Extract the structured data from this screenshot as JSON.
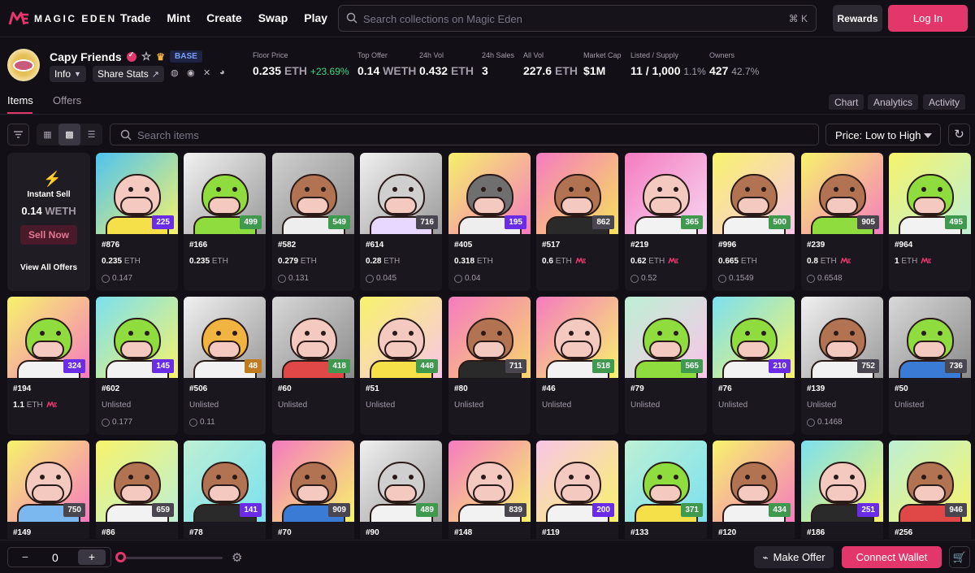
{
  "header": {
    "brand": "MAGIC EDEN",
    "nav": [
      "Trade",
      "Mint",
      "Create",
      "Swap",
      "Play"
    ],
    "search_placeholder": "Search collections on Magic Eden",
    "search_shortcut": "⌘ K",
    "rewards_label": "Rewards",
    "login_label": "Log In"
  },
  "collection": {
    "name": "Capy Friends",
    "chain": "BASE",
    "info_label": "Info",
    "share_label": "Share Stats",
    "stats": [
      {
        "label": "Floor Price",
        "value": "0.235",
        "unit": "ETH",
        "extra": "+23.69%"
      },
      {
        "label": "Top Offer",
        "value": "0.14",
        "unit": "WETH",
        "extra": ""
      },
      {
        "label": "24h Vol",
        "value": "0.432",
        "unit": "ETH",
        "extra": ""
      },
      {
        "label": "24h Sales",
        "value": "3",
        "unit": "",
        "extra": ""
      },
      {
        "label": "All Vol",
        "value": "227.6",
        "unit": "ETH",
        "extra": ""
      },
      {
        "label": "Market Cap",
        "value": "$1M",
        "unit": "",
        "extra": ""
      },
      {
        "label": "Listed / Supply",
        "value": "11 / 1,000",
        "unit": "",
        "extra": "1.1%"
      },
      {
        "label": "Owners",
        "value": "427",
        "unit": "",
        "extra": "42.7%"
      }
    ]
  },
  "tabs": {
    "items": "Items",
    "offers": "Offers",
    "right": [
      "Chart",
      "Analytics",
      "Activity"
    ]
  },
  "toolbar": {
    "search_placeholder": "Search items",
    "sort_label": "Price: Low to High"
  },
  "instant_sell": {
    "title": "Instant Sell",
    "price": "0.14",
    "unit": "WETH",
    "button": "Sell Now",
    "link": "View All Offers"
  },
  "cards": [
    {
      "id": "#876",
      "rank": "225",
      "rank_color": "#6b2ce8",
      "price": "0.235",
      "me": false,
      "last": "0.147",
      "bg": "linear-gradient(135deg,#4ec3f0,#f7f36b)",
      "body": "#f3c9c0",
      "shirt": "#f5e04a"
    },
    {
      "id": "#166",
      "rank": "499",
      "rank_color": "#3f9a4f",
      "price": "0.235",
      "me": false,
      "last": "",
      "bg": "linear-gradient(135deg,#f2f2f2,#9a9a9a)",
      "body": "#8fdc3f",
      "shirt": "#8fdc3f"
    },
    {
      "id": "#582",
      "rank": "549",
      "rank_color": "#3f9a4f",
      "price": "0.279",
      "me": false,
      "last": "0.131",
      "bg": "linear-gradient(135deg,#d0d0d0,#8a8a8a)",
      "body": "#b27352",
      "shirt": "#eeeeee"
    },
    {
      "id": "#614",
      "rank": "716",
      "rank_color": "#4a4650",
      "price": "0.28",
      "me": false,
      "last": "0.045",
      "bg": "linear-gradient(135deg,#f0f0f0,#9a9a9a)",
      "body": "#cfcfcf",
      "shirt": "#e8d7ff"
    },
    {
      "id": "#405",
      "rank": "195",
      "rank_color": "#6b2ce8",
      "price": "0.318",
      "me": false,
      "last": "0.04",
      "bg": "linear-gradient(135deg,#f5f06b,#f57bc0)",
      "body": "#6f6f6f",
      "shirt": "#eeeeee"
    },
    {
      "id": "#517",
      "rank": "862",
      "rank_color": "#4a4650",
      "price": "0.6",
      "me": true,
      "last": "",
      "bg": "linear-gradient(135deg,#f57bc0,#f7e35b)",
      "body": "#b27352",
      "shirt": "#2a2a2a"
    },
    {
      "id": "#219",
      "rank": "365",
      "rank_color": "#3f9a4f",
      "price": "0.62",
      "me": true,
      "last": "0.52",
      "bg": "linear-gradient(135deg,#f57bc0,#f6d7f2)",
      "body": "#f3c9c0",
      "shirt": "#f2f2f2"
    },
    {
      "id": "#996",
      "rank": "500",
      "rank_color": "#3f9a4f",
      "price": "0.665",
      "me": false,
      "last": "0.1549",
      "bg": "linear-gradient(135deg,#f7f36b,#f9c5e8)",
      "body": "#b27352",
      "shirt": "#f2f2f2"
    },
    {
      "id": "#239",
      "rank": "905",
      "rank_color": "#4a4650",
      "price": "0.8",
      "me": true,
      "last": "0.6548",
      "bg": "linear-gradient(135deg,#f7f36b,#f57bc0)",
      "body": "#b27352",
      "shirt": "#8fdc3f"
    },
    {
      "id": "#964",
      "rank": "495",
      "rank_color": "#3f9a4f",
      "price": "1",
      "me": true,
      "last": "",
      "bg": "linear-gradient(135deg,#f7f36b,#bdf0d4)",
      "body": "#8fdc3f",
      "shirt": "#f2f2f2"
    },
    {
      "id": "#194",
      "rank": "324",
      "rank_color": "#6b2ce8",
      "price": "1.1",
      "me": true,
      "last": "",
      "bg": "linear-gradient(135deg,#f7f36b,#f57bc0)",
      "body": "#8fdc3f",
      "shirt": "#f2f2f2"
    },
    {
      "id": "#602",
      "rank": "145",
      "rank_color": "#6b2ce8",
      "price": "",
      "me": false,
      "last": "0.177",
      "bg": "linear-gradient(135deg,#7be0f0,#f7f36b)",
      "body": "#8fdc3f",
      "shirt": "#f2f2f2"
    },
    {
      "id": "#506",
      "rank": "48",
      "rank_color": "#c07a1f",
      "price": "",
      "me": false,
      "last": "0.11",
      "bg": "linear-gradient(135deg,#f0f0f0,#9a9a9a)",
      "body": "#f2b441",
      "shirt": "#f2f2f2"
    },
    {
      "id": "#60",
      "rank": "418",
      "rank_color": "#3f9a4f",
      "price": "",
      "me": false,
      "last": "",
      "bg": "linear-gradient(135deg,#d8d8d8,#8a8a8a)",
      "body": "#f3c9c0",
      "shirt": "#e04848"
    },
    {
      "id": "#51",
      "rank": "448",
      "rank_color": "#3f9a4f",
      "price": "",
      "me": false,
      "last": "",
      "bg": "linear-gradient(135deg,#f7f36b,#f9c5e8)",
      "body": "#f3c9c0",
      "shirt": "#f5e04a"
    },
    {
      "id": "#80",
      "rank": "711",
      "rank_color": "#4a4650",
      "price": "",
      "me": false,
      "last": "",
      "bg": "linear-gradient(135deg,#f57bc0,#f7d66b)",
      "body": "#b27352",
      "shirt": "#2a2a2a"
    },
    {
      "id": "#46",
      "rank": "518",
      "rank_color": "#3f9a4f",
      "price": "",
      "me": false,
      "last": "",
      "bg": "linear-gradient(135deg,#f57bc0,#f7f36b)",
      "body": "#f3c9c0",
      "shirt": "#f2f2f2"
    },
    {
      "id": "#79",
      "rank": "565",
      "rank_color": "#3f9a4f",
      "price": "",
      "me": false,
      "last": "",
      "bg": "linear-gradient(135deg,#bdf0d4,#f9c5e8)",
      "body": "#8fdc3f",
      "shirt": "#8fdc3f"
    },
    {
      "id": "#76",
      "rank": "210",
      "rank_color": "#6b2ce8",
      "price": "",
      "me": false,
      "last": "",
      "bg": "linear-gradient(135deg,#7be0f0,#f7f36b)",
      "body": "#8fdc3f",
      "shirt": "#f2f2f2"
    },
    {
      "id": "#139",
      "rank": "752",
      "rank_color": "#4a4650",
      "price": "",
      "me": false,
      "last": "0.1468",
      "bg": "linear-gradient(135deg,#f0f0f0,#9a9a9a)",
      "body": "#b27352",
      "shirt": "#f2f2f2"
    },
    {
      "id": "#50",
      "rank": "736",
      "rank_color": "#4a4650",
      "price": "",
      "me": false,
      "last": "",
      "bg": "linear-gradient(135deg,#d8d8d8,#8a8a8a)",
      "body": "#8fdc3f",
      "shirt": "#3a7bd5"
    },
    {
      "id": "#149",
      "rank": "750",
      "rank_color": "#4a4650",
      "price": "",
      "me": false,
      "last": "",
      "bg": "linear-gradient(135deg,#f7f36b,#f57bc0)",
      "body": "#f3c9c0",
      "shirt": "#7bb8f0"
    },
    {
      "id": "#86",
      "rank": "659",
      "rank_color": "#4a4650",
      "price": "",
      "me": false,
      "last": "",
      "bg": "linear-gradient(135deg,#f7f36b,#bdf0d4)",
      "body": "#b27352",
      "shirt": "#f2f2f2"
    },
    {
      "id": "#78",
      "rank": "141",
      "rank_color": "#6b2ce8",
      "price": "",
      "me": false,
      "last": "",
      "bg": "linear-gradient(135deg,#bdf0d4,#7be0f0)",
      "body": "#b27352",
      "shirt": "#2a2a2a"
    },
    {
      "id": "#70",
      "rank": "909",
      "rank_color": "#4a4650",
      "price": "",
      "me": false,
      "last": "",
      "bg": "linear-gradient(135deg,#f57bc0,#f7f36b)",
      "body": "#b27352",
      "shirt": "#3a7bd5"
    },
    {
      "id": "#90",
      "rank": "489",
      "rank_color": "#3f9a4f",
      "price": "",
      "me": false,
      "last": "",
      "bg": "linear-gradient(135deg,#f0f0f0,#9a9a9a)",
      "body": "#cfcfcf",
      "shirt": "#f2f2f2"
    },
    {
      "id": "#148",
      "rank": "839",
      "rank_color": "#4a4650",
      "price": "",
      "me": false,
      "last": "",
      "bg": "linear-gradient(135deg,#f57bc0,#f7f36b)",
      "body": "#f3c9c0",
      "shirt": "#f2f2f2"
    },
    {
      "id": "#119",
      "rank": "200",
      "rank_color": "#6b2ce8",
      "price": "",
      "me": false,
      "last": "",
      "bg": "linear-gradient(135deg,#f9c5e8,#f7f36b)",
      "body": "#f3c9c0",
      "shirt": "#f2f2f2"
    },
    {
      "id": "#133",
      "rank": "371",
      "rank_color": "#3f9a4f",
      "price": "",
      "me": false,
      "last": "",
      "bg": "linear-gradient(135deg,#bdf0d4,#7be0f0)",
      "body": "#8fdc3f",
      "shirt": "#f5e04a"
    },
    {
      "id": "#120",
      "rank": "434",
      "rank_color": "#3f9a4f",
      "price": "",
      "me": false,
      "last": "",
      "bg": "linear-gradient(135deg,#f7f36b,#f57bc0)",
      "body": "#b27352",
      "shirt": "#f2f2f2"
    },
    {
      "id": "#186",
      "rank": "251",
      "rank_color": "#6b2ce8",
      "price": "",
      "me": false,
      "last": "",
      "bg": "linear-gradient(135deg,#7be0f0,#f7f36b)",
      "body": "#f3c9c0",
      "shirt": "#2a2a2a"
    },
    {
      "id": "#256",
      "rank": "946",
      "rank_color": "#4a4650",
      "price": "",
      "me": false,
      "last": "",
      "bg": "linear-gradient(135deg,#bdf0d4,#f7f36b)",
      "body": "#b27352",
      "shirt": "#e04848"
    }
  ],
  "labels": {
    "eth": "ETH",
    "unlisted": "Unlisted"
  },
  "bottom": {
    "qty": "0",
    "minus": "−",
    "plus": "+",
    "make_offer": "Make Offer",
    "connect": "Connect Wallet"
  },
  "colors": {
    "accent": "#e3376b",
    "positive": "#42d982"
  }
}
